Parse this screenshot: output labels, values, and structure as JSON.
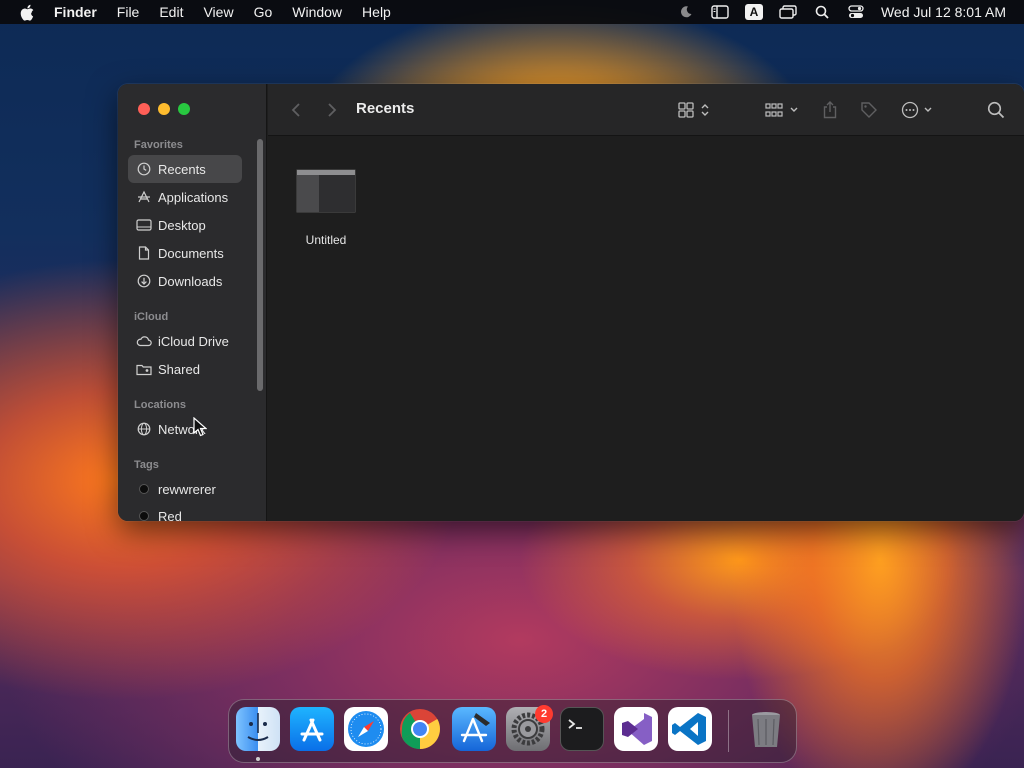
{
  "menubar": {
    "app_name": "Finder",
    "items": [
      "File",
      "Edit",
      "View",
      "Go",
      "Window",
      "Help"
    ],
    "input_source": "A",
    "clock": "Wed Jul 12  8:01 AM"
  },
  "finder": {
    "title": "Recents",
    "sidebar": {
      "favorites_header": "Favorites",
      "favorites": [
        {
          "label": "Recents",
          "icon": "clock-icon",
          "selected": true
        },
        {
          "label": "Applications",
          "icon": "apps-icon"
        },
        {
          "label": "Desktop",
          "icon": "desktop-icon"
        },
        {
          "label": "Documents",
          "icon": "document-icon"
        },
        {
          "label": "Downloads",
          "icon": "download-icon"
        }
      ],
      "icloud_header": "iCloud",
      "icloud": [
        {
          "label": "iCloud Drive",
          "icon": "cloud-icon"
        },
        {
          "label": "Shared",
          "icon": "shared-folder-icon"
        }
      ],
      "locations_header": "Locations",
      "locations": [
        {
          "label": "Network",
          "icon": "globe-icon"
        }
      ],
      "tags_header": "Tags",
      "tags": [
        {
          "label": "rewwrerer",
          "color": "#0c0c0c"
        },
        {
          "label": "Red",
          "color": "#0c0c0c"
        }
      ]
    },
    "files": [
      {
        "name": "Untitled",
        "icon": "window-thumbnail-icon"
      }
    ]
  },
  "dock": {
    "apps": [
      {
        "name": "Finder",
        "icon": "finder-icon",
        "running": true
      },
      {
        "name": "App Store",
        "icon": "app-store-icon"
      },
      {
        "name": "Safari",
        "icon": "safari-icon"
      },
      {
        "name": "Google Chrome",
        "icon": "chrome-icon"
      },
      {
        "name": "Xcode",
        "icon": "xcode-icon"
      },
      {
        "name": "System Settings",
        "icon": "settings-icon",
        "badge": "2"
      },
      {
        "name": "Terminal",
        "icon": "terminal-icon"
      },
      {
        "name": "Visual Studio",
        "icon": "visual-studio-icon"
      },
      {
        "name": "Visual Studio Code",
        "icon": "vscode-icon"
      },
      {
        "name": "Trash",
        "icon": "trash-icon"
      }
    ]
  },
  "colors": {
    "window_bg": "#1e1e1e",
    "sidebar_bg": "#2b2b2d",
    "selected_row": "#474749",
    "close": "#ff5f57",
    "minimize": "#febc2e",
    "maximize": "#28c840",
    "badge": "#ff3b30"
  }
}
